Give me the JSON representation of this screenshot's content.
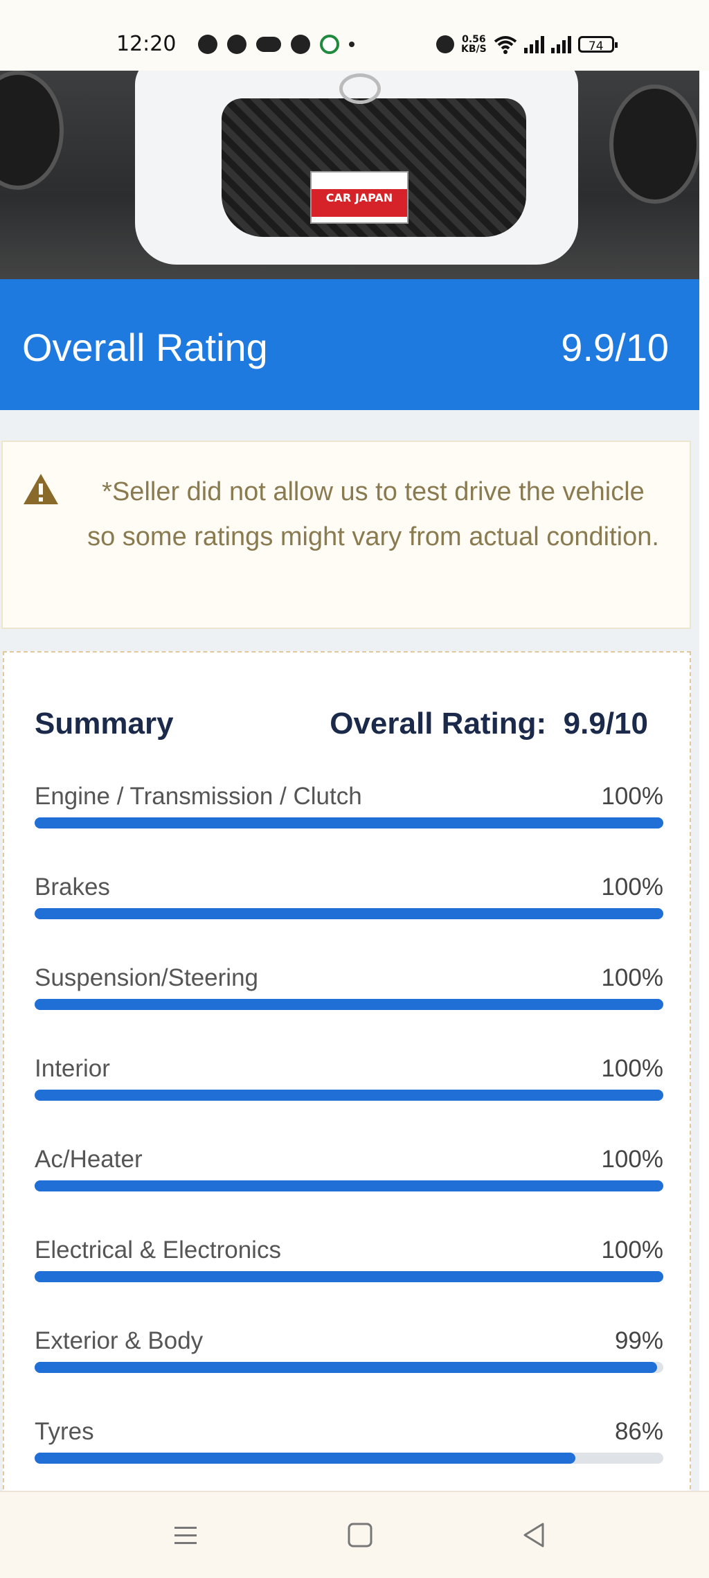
{
  "status_bar": {
    "time": "12:20",
    "speed": "0.56\nKB/S",
    "battery": "74"
  },
  "rating_banner": {
    "label": "Overall Rating",
    "value": "9.9/10"
  },
  "warning": {
    "text": "*Seller did not allow us to test drive the vehicle so some ratings might vary from actual condition."
  },
  "summary": {
    "title": "Summary",
    "overall_label": "Overall Rating:",
    "overall_value": "9.9/10",
    "items": [
      {
        "label": "Engine / Transmission / Clutch",
        "percent": "100%",
        "value": 100
      },
      {
        "label": "Brakes",
        "percent": "100%",
        "value": 100
      },
      {
        "label": "Suspension/Steering",
        "percent": "100%",
        "value": 100
      },
      {
        "label": "Interior",
        "percent": "100%",
        "value": 100
      },
      {
        "label": "Ac/Heater",
        "percent": "100%",
        "value": 100
      },
      {
        "label": "Electrical & Electronics",
        "percent": "100%",
        "value": 100
      },
      {
        "label": "Exterior & Body",
        "percent": "99%",
        "value": 99
      },
      {
        "label": "Tyres",
        "percent": "86%",
        "value": 86
      }
    ]
  },
  "hero_plate": {
    "main": "CAR JAPAN"
  },
  "colors": {
    "accent": "#1f7ae0",
    "bar_fill": "#1f6fd6",
    "warning_text": "#8a7a50",
    "warning_icon": "#8a6a2a"
  }
}
